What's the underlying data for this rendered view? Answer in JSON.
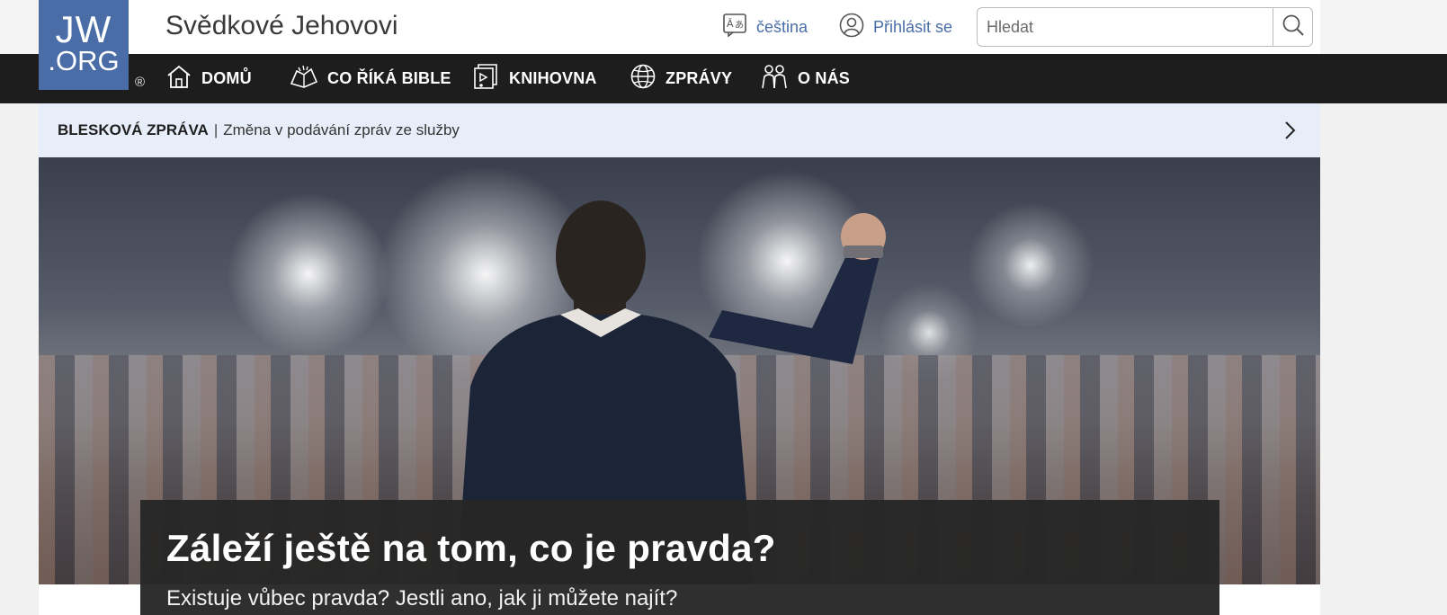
{
  "logo": {
    "line1": "JW",
    "line2": ".ORG",
    "registered": "®"
  },
  "header": {
    "site_title": "Svědkové Jehovovi",
    "language_label": "čeština",
    "login_label": "Přihlásit se",
    "search_placeholder": "Hledat"
  },
  "nav": {
    "items": [
      {
        "label": "DOMŮ",
        "icon": "home-icon"
      },
      {
        "label": "CO ŘÍKÁ BIBLE",
        "icon": "open-bible-icon"
      },
      {
        "label": "KNIHOVNA",
        "icon": "media-library-icon"
      },
      {
        "label": "ZPRÁVY",
        "icon": "globe-icon"
      },
      {
        "label": "O NÁS",
        "icon": "people-icon"
      }
    ]
  },
  "flash_news": {
    "kicker": "BLESKOVÁ ZPRÁVA",
    "separator": "|",
    "text": "Změna v podávání zpráv ze služby"
  },
  "hero": {
    "image": "man-raising-fist-before-cheering-crowd",
    "headline": "Záleží ještě na tom, co je pravda?",
    "subheadline": "Existuje vůbec pravda? Jestli ano, jak ji můžete najít?"
  },
  "colors": {
    "brand_blue": "#4a6da7",
    "nav_background": "#1d1d1d",
    "flash_background": "#e8eef9"
  }
}
